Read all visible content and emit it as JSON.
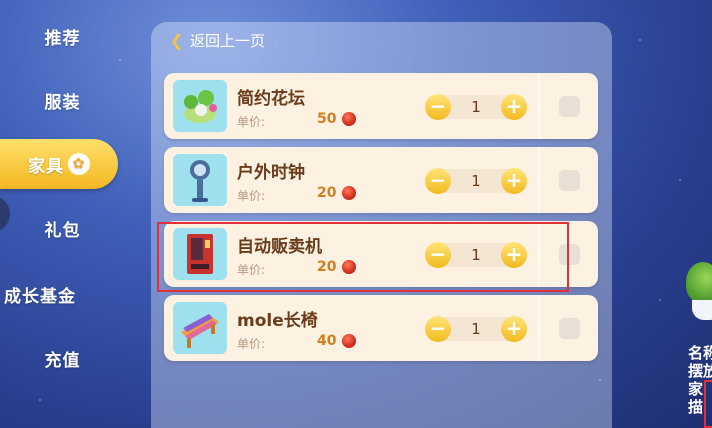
{
  "sidebar": {
    "items": [
      {
        "label": "推荐"
      },
      {
        "label": "服装"
      },
      {
        "label": "家具",
        "active": true
      },
      {
        "label": "礼包"
      },
      {
        "label": "成长基金"
      },
      {
        "label": "充值"
      }
    ]
  },
  "header": {
    "back_label": "返回上一页"
  },
  "items": [
    {
      "name": "简约花坛",
      "price_label": "单价:",
      "price": "50",
      "quantity": "1",
      "thumb_icon": "flower-planter-icon"
    },
    {
      "name": "户外时钟",
      "price_label": "单价:",
      "price": "20",
      "quantity": "1",
      "thumb_icon": "outdoor-clock-icon"
    },
    {
      "name": "自动贩卖机",
      "price_label": "单价:",
      "price": "20",
      "quantity": "1",
      "thumb_icon": "vending-machine-icon"
    },
    {
      "name": "mole长椅",
      "price_label": "单价:",
      "price": "40",
      "quantity": "1",
      "thumb_icon": "bench-icon"
    }
  ],
  "detail_peek": {
    "lines": [
      "名称",
      "摆放",
      "家",
      "描"
    ]
  },
  "colors": {
    "accent": "#f4b722",
    "highlight": "#e0303a",
    "item_bg": "#fdf2e2",
    "text_brown": "#6b3c1c"
  }
}
